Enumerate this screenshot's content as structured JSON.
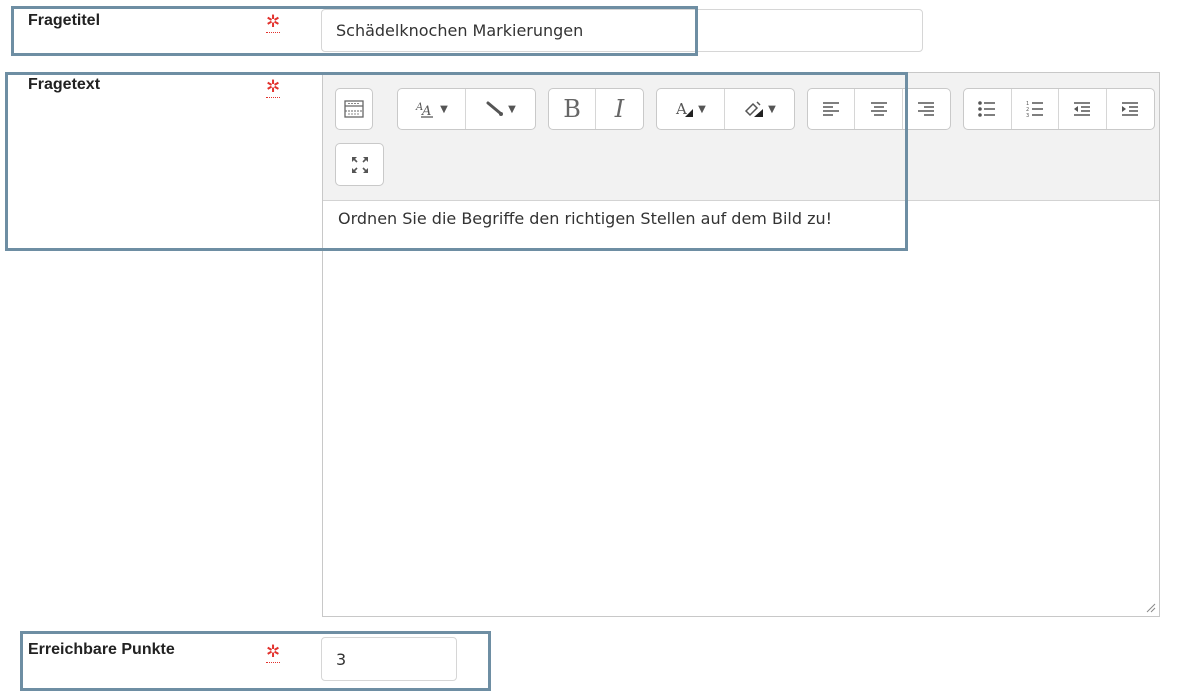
{
  "fields": {
    "title": {
      "label": "Fragetitel",
      "required_marker": "✲",
      "value": "Schädelknochen Markierungen"
    },
    "text": {
      "label": "Fragetext",
      "required_marker": "✲",
      "value": "Ordnen Sie die Begriffe den richtigen Stellen auf dem Bild zu!"
    },
    "points": {
      "label": "Erreichbare Punkte",
      "required_marker": "✲",
      "value": "3"
    }
  },
  "toolbar": {
    "bold_label": "B",
    "italic_label": "I",
    "icons": [
      "toolbar-toggle-icon",
      "font-family-icon",
      "paragraph-style-icon",
      "bold-icon",
      "italic-icon",
      "font-color-icon",
      "background-color-icon",
      "align-left-icon",
      "align-center-icon",
      "align-right-icon",
      "unordered-list-icon",
      "ordered-list-icon",
      "outdent-icon",
      "indent-icon",
      "fullscreen-icon"
    ]
  },
  "colors": {
    "required": "#e2322d",
    "highlight_border": "#6e8ea3",
    "toolbar_bg": "#f2f2f2"
  }
}
